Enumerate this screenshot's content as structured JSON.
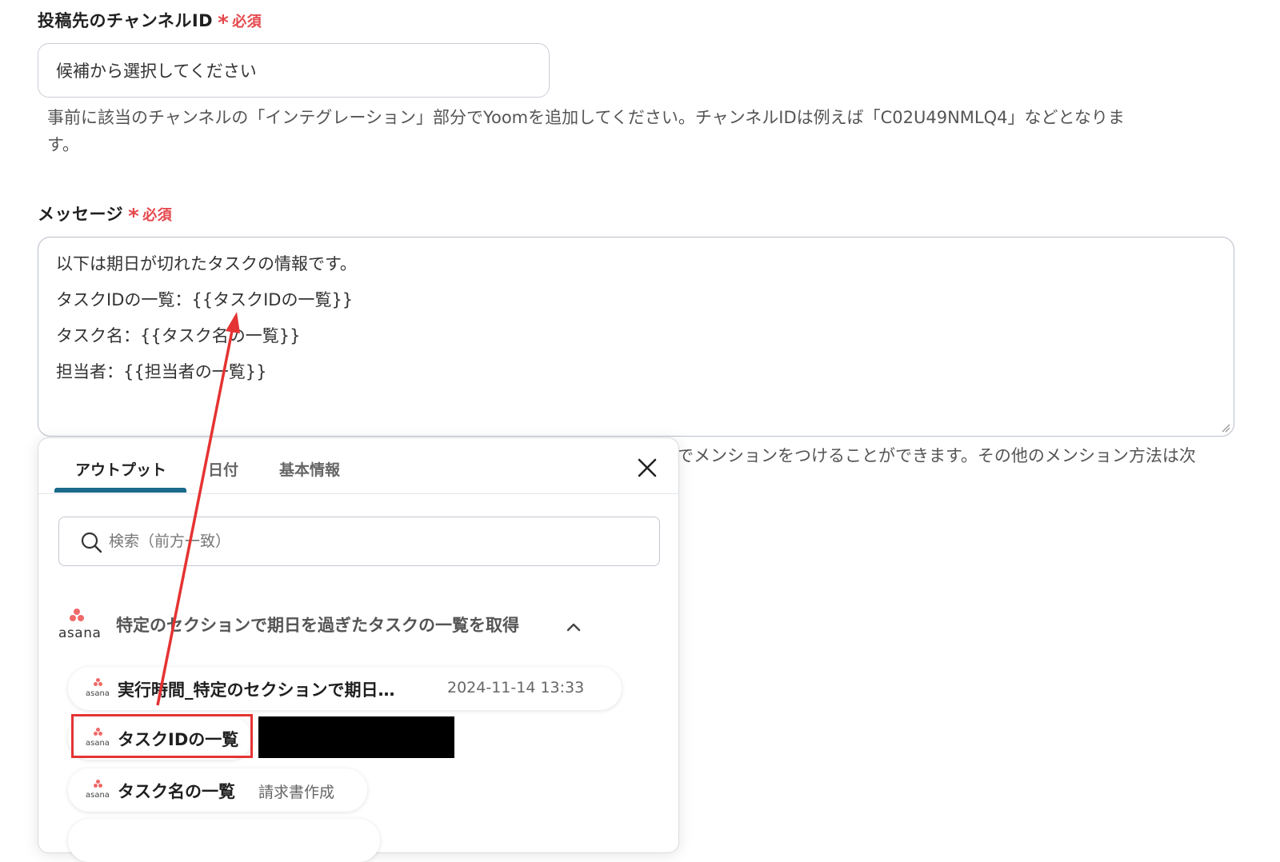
{
  "channel_field": {
    "label": "投稿先のチャンネルID",
    "required_star": "*",
    "required_text": "必須",
    "placeholder": "候補から選択してください",
    "help_line1": "事前に該当のチャンネルの「インテグレーション」部分でYoomを追加してください。チャンネルIDは例えば「C02U49NMLQ4」などとなりま",
    "help_line2": "す。"
  },
  "message_field": {
    "label": "メッセージ",
    "required_star": "*",
    "required_text": "必須",
    "lines": [
      "以下は期日が切れたタスクの情報です。",
      "タスクIDの一覧：{{タスクIDの一覧}}",
      "タスク名：{{タスク名の一覧}}",
      "担当者：{{担当者の一覧}}"
    ],
    "help_partial": "でメンションをつけることができます。その他のメンション方法は次"
  },
  "popup": {
    "tabs": [
      {
        "label": "アウトプット",
        "active": true
      },
      {
        "label": "日付",
        "active": false
      },
      {
        "label": "基本情報",
        "active": false
      }
    ],
    "search_placeholder": "検索（前方一致）",
    "group": {
      "app_logo_text": "asana",
      "title": "特定のセクションで期日を過ぎたタスクの一覧を取得"
    },
    "items": [
      {
        "name": "実行時間_特定のセクションで期日…",
        "value": "2024-11-14 13:33"
      },
      {
        "name": "タスクIDの一覧",
        "value": ""
      },
      {
        "name": "タスク名の一覧",
        "value": "請求書作成"
      }
    ],
    "chip_logo_text": "asana"
  },
  "colors": {
    "required": "#e5484d",
    "tab_accent": "#1a6a8a",
    "asana": "#f06a6a",
    "annotation": "#e53333"
  }
}
